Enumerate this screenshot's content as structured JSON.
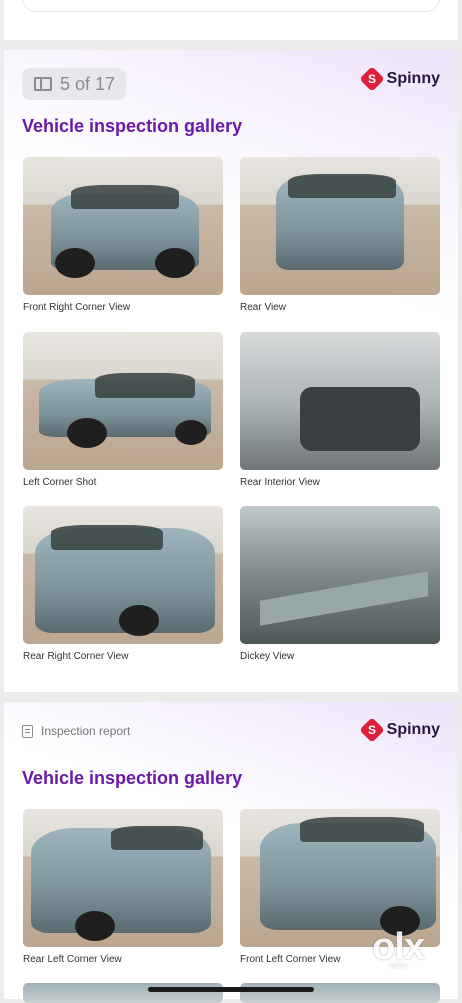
{
  "gallery1": {
    "page_indicator": "5 of 17",
    "brand": {
      "mark": "S",
      "name": "Spinny",
      "color": "#e0203a"
    },
    "title": "Vehicle inspection gallery",
    "photos": [
      {
        "caption": "Front Right Corner View"
      },
      {
        "caption": "Rear View"
      },
      {
        "caption": "Left Corner Shot"
      },
      {
        "caption": "Rear Interior View"
      },
      {
        "caption": "Rear Right Corner View"
      },
      {
        "caption": "Dickey View"
      }
    ]
  },
  "gallery2": {
    "report_label": "Inspection report",
    "brand": {
      "mark": "S",
      "name": "Spinny"
    },
    "title": "Vehicle inspection gallery",
    "photos": [
      {
        "caption": "Rear Left Corner View"
      },
      {
        "caption": "Front Left Corner View"
      }
    ]
  },
  "watermark": {
    "text": "olx",
    "sub": "INDIA"
  },
  "colors": {
    "title_purple": "#6a1aa6",
    "brand_red": "#e0203a",
    "page_bg": "#ececec"
  }
}
